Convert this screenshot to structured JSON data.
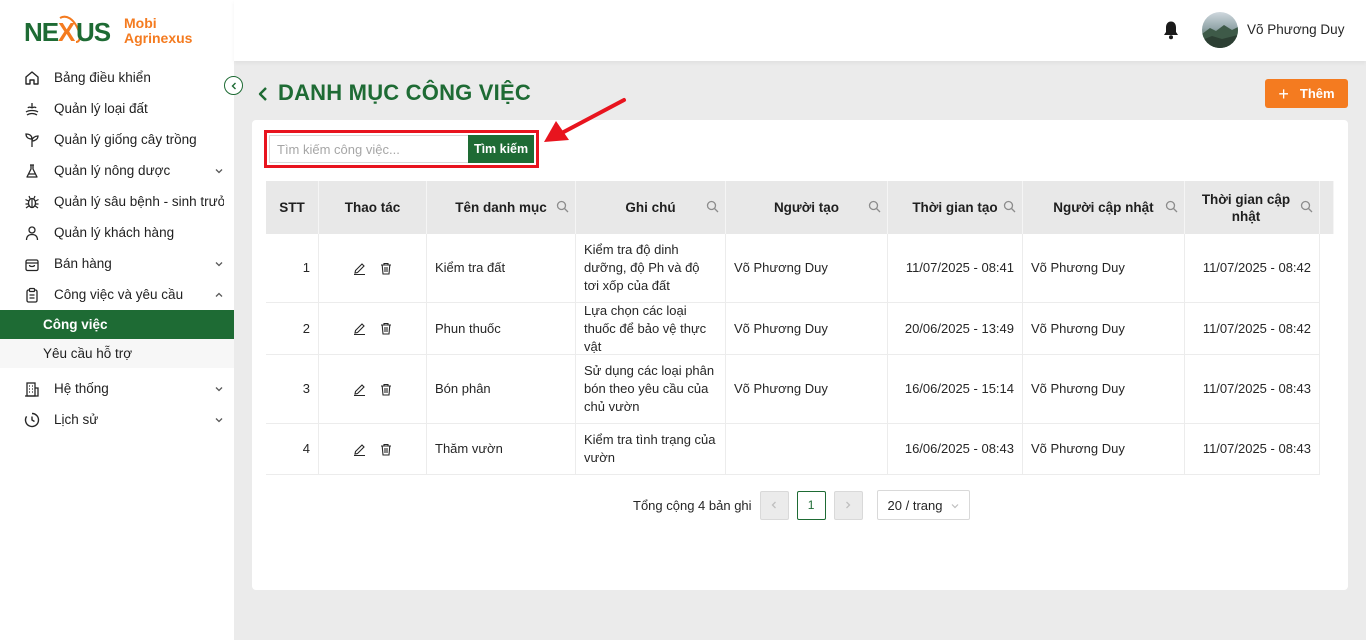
{
  "brand": {
    "line1": "Mobi",
    "line2": "Agrinexus",
    "logo_text": "NEXUS"
  },
  "sidebar": {
    "items": [
      {
        "label": "Bảng điều khiển",
        "icon": "home-icon"
      },
      {
        "label": "Quản lý loại đất",
        "icon": "soil-icon"
      },
      {
        "label": "Quản lý giống cây trồng",
        "icon": "plant-icon"
      },
      {
        "label": "Quản lý nông dược",
        "icon": "flask-icon",
        "expandable": true
      },
      {
        "label": "Quản lý sâu bệnh - sinh trưởng",
        "icon": "bug-icon"
      },
      {
        "label": "Quản lý khách hàng",
        "icon": "user-icon"
      },
      {
        "label": "Bán hàng",
        "icon": "shopping-bag-icon",
        "expandable": true
      },
      {
        "label": "Công việc và yêu cầu",
        "icon": "clipboard-icon",
        "expanded": true
      }
    ],
    "subitems": [
      {
        "label": "Công việc",
        "active": true
      },
      {
        "label": "Yêu cầu hỗ trợ",
        "active": false
      }
    ],
    "bottom_items": [
      {
        "label": "Hệ thống",
        "icon": "building-icon",
        "expandable": true
      },
      {
        "label": "Lịch sử",
        "icon": "history-icon",
        "expandable": true
      }
    ]
  },
  "header": {
    "user_name": "Võ Phương Duy"
  },
  "page": {
    "title": "DANH MỤC CÔNG VIỆC",
    "add_label": "Thêm"
  },
  "search": {
    "placeholder": "Tìm kiếm công việc...",
    "value": "",
    "button_label": "Tìm kiếm"
  },
  "table": {
    "columns": [
      "STT",
      "Thao tác",
      "Tên danh mục",
      "Ghi chú",
      "Người tạo",
      "Thời gian tạo",
      "Người cập nhật",
      "Thời gian cập nhật"
    ],
    "rows": [
      {
        "stt": "1",
        "name": "Kiểm tra đất",
        "note": "Kiểm tra độ dinh dưỡng, độ Ph và độ tơi xốp của đất",
        "creator": "Võ Phương Duy",
        "created": "11/07/2025 - 08:41",
        "updater": "Võ Phương Duy",
        "updated": "11/07/2025 - 08:42"
      },
      {
        "stt": "2",
        "name": "Phun thuốc",
        "note": "Lựa chọn các loại thuốc để bảo vệ thực vật",
        "creator": "Võ Phương Duy",
        "created": "20/06/2025 - 13:49",
        "updater": "Võ Phương Duy",
        "updated": "11/07/2025 - 08:42"
      },
      {
        "stt": "3",
        "name": "Bón phân",
        "note": "Sử dụng các loại phân bón theo yêu cầu của chủ vườn",
        "creator": "Võ Phương Duy",
        "created": "16/06/2025 - 15:14",
        "updater": "Võ Phương Duy",
        "updated": "11/07/2025 - 08:43"
      },
      {
        "stt": "4",
        "name": "Thăm vườn",
        "note": "Kiểm tra tình trạng của vườn",
        "creator": "",
        "created": "16/06/2025 - 08:43",
        "updater": "Võ Phương Duy",
        "updated": "11/07/2025 - 08:43"
      }
    ]
  },
  "pagination": {
    "total_label": "Tổng cộng 4 bản ghi",
    "current_page": "1",
    "page_size": "20 / trang"
  },
  "colors": {
    "primary_green": "#1e6b34",
    "accent_orange": "#f47b20",
    "highlight_red": "#e8141e"
  }
}
